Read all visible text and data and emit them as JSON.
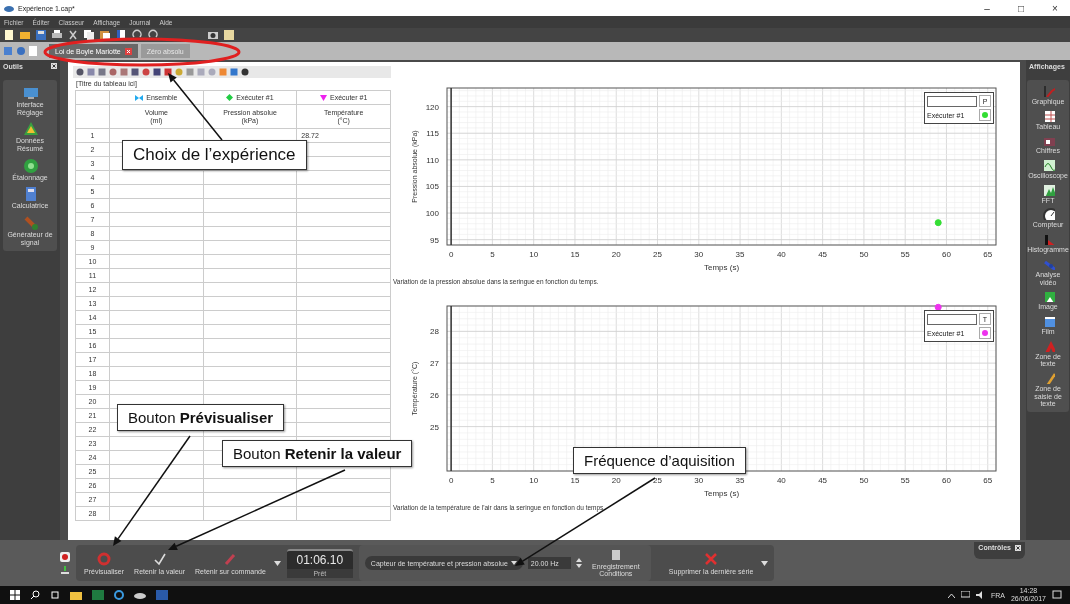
{
  "window": {
    "title": "Expérience 1.cap*",
    "controls": [
      "–",
      "□",
      "×"
    ]
  },
  "menu": [
    "Fichier",
    "Éditer",
    "Classeur",
    "Affichage",
    "Journal",
    "Aide"
  ],
  "tabs": [
    {
      "label": "Loi de Boyle Mariotte",
      "selected": true
    },
    {
      "label": "Zéro absolu",
      "selected": false
    }
  ],
  "tools_panel": {
    "title": "Outils",
    "items": [
      "Interface Réglage",
      "Données Résumé",
      "Étalonnage",
      "Calculatrice",
      "Générateur de signal"
    ]
  },
  "table": {
    "title": "[Titre du tableau ici]",
    "groups": [
      {
        "label": "Ensemble",
        "kind": "bowtie",
        "color": "#22aaee"
      },
      {
        "label": "Exécuter #1",
        "kind": "diamond",
        "color": "#22cc44"
      },
      {
        "label": "Exécuter #1",
        "kind": "triangle",
        "color": "#ee22ee"
      }
    ],
    "columns": [
      {
        "name": "Volume",
        "unit": "(ml)"
      },
      {
        "name": "Pression absolue",
        "unit": "(kPa)"
      },
      {
        "name": "Température",
        "unit": "(°C)"
      }
    ],
    "rows": [
      {
        "number": "1",
        "temperature": "28.72"
      },
      {
        "number": "2"
      },
      {
        "number": "3"
      },
      {
        "number": "4"
      },
      {
        "number": "5"
      },
      {
        "number": "6"
      },
      {
        "number": "7"
      },
      {
        "number": "8"
      },
      {
        "number": "9"
      },
      {
        "number": "10"
      },
      {
        "number": "11"
      },
      {
        "number": "12"
      },
      {
        "number": "13"
      },
      {
        "number": "14"
      },
      {
        "number": "15"
      },
      {
        "number": "16"
      },
      {
        "number": "17"
      },
      {
        "number": "18"
      },
      {
        "number": "19"
      },
      {
        "number": "20"
      },
      {
        "number": "21"
      },
      {
        "number": "22"
      },
      {
        "number": "23"
      },
      {
        "number": "24"
      },
      {
        "number": "25"
      },
      {
        "number": "26"
      },
      {
        "number": "27"
      },
      {
        "number": "28"
      }
    ]
  },
  "charts": [
    {
      "chart_data": {
        "type": "scatter",
        "xlabel": "Temps (s)",
        "ylabel": "Pression absolue (kPa)",
        "xlim": [
          -0.5,
          66
        ],
        "ylim": [
          94,
          123.5
        ],
        "xticks": [
          0,
          5,
          10,
          15,
          20,
          25,
          30,
          35,
          40,
          45,
          50,
          55,
          60,
          65
        ],
        "yticks": [
          95,
          100,
          105,
          110,
          115,
          120
        ],
        "x": [
          59
        ],
        "grid": true,
        "series": [
          {
            "name": "Exécuter #1",
            "color": "#33dd33",
            "values": [
              98.2
            ]
          }
        ]
      },
      "legend": {
        "symbol": "P"
      },
      "caption": "Variation de la pression absolue dans la seringue en fonction du temps."
    },
    {
      "chart_data": {
        "type": "scatter",
        "xlabel": "Temps (s)",
        "ylabel": "Température (°C)",
        "xlim": [
          -0.5,
          66
        ],
        "ylim": [
          23.6,
          28.8
        ],
        "xticks": [
          0,
          5,
          10,
          15,
          20,
          25,
          30,
          35,
          40,
          45,
          50,
          55,
          60,
          65
        ],
        "yticks": [
          25,
          26,
          27,
          28
        ],
        "x": [
          59
        ],
        "grid": true,
        "series": [
          {
            "name": "Exécuter #1",
            "color": "#ee33ee",
            "values": [
              28.76
            ]
          }
        ]
      },
      "legend": {
        "symbol": "T"
      },
      "caption": "Variation de la température de l'air dans la seringue en fonction du temps."
    }
  ],
  "displays_panel": {
    "title": "Affichages",
    "items": [
      "Graphique",
      "Tableau",
      "Chiffres",
      "Oscilloscope",
      "FFT",
      "Compteur",
      "Histogramme",
      "Analyse vidéo",
      "Image",
      "Film",
      "Zone de texte",
      "Zone de saisie de texte"
    ]
  },
  "controls": {
    "buttons": [
      {
        "label": "Prévisualiser",
        "kind": "preview"
      },
      {
        "label": "Retenir la valeur",
        "kind": "keep"
      },
      {
        "label": "Retenir sur commande",
        "kind": "command"
      }
    ],
    "timer": {
      "value": "01:06.10",
      "status": "Prêt"
    },
    "sensor": "Capteur de température et pression absolue",
    "frequency": "20.00 Hz",
    "conditions": "Enregistrement Conditions",
    "delete": "Supprimer la dernière série",
    "panel_title": "Contrôles"
  },
  "taskbar": {
    "language": "FRA",
    "time": "14:28",
    "date": "26/06/2017"
  },
  "annotations": [
    {
      "text": "Choix de l’expérience"
    },
    {
      "text": "Bouton **Prévisualiser**"
    },
    {
      "text": "Bouton **Retenir la valeur**"
    },
    {
      "text": "Fréquence d’aquisition"
    }
  ]
}
